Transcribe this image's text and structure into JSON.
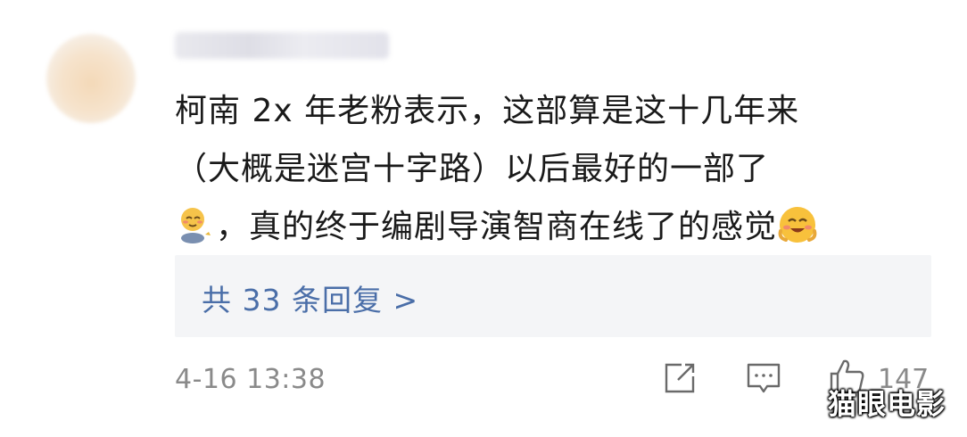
{
  "comment": {
    "lines": [
      "柯南 2x 年老粉表示，这部算是这十几年来",
      "（大概是迷宫十字路）以后最好的一部了",
      "，真的终于编剧导演智商在线了的感觉"
    ]
  },
  "replies": {
    "label": "共 33 条回复 >"
  },
  "footer": {
    "timestamp": "4-16 13:38",
    "like_count": "147"
  },
  "icons": {
    "emoji_start": "shy-face-emoji-icon",
    "emoji_end": "blushing-smile-emoji-icon",
    "share": "share-icon",
    "reply": "comment-icon",
    "like": "thumbs-up-icon"
  },
  "watermark": {
    "text": "猫眼电影"
  },
  "colors": {
    "link": "#4a6ea8",
    "meta": "#8a8a8a",
    "reply_box": "#f4f5f7"
  }
}
